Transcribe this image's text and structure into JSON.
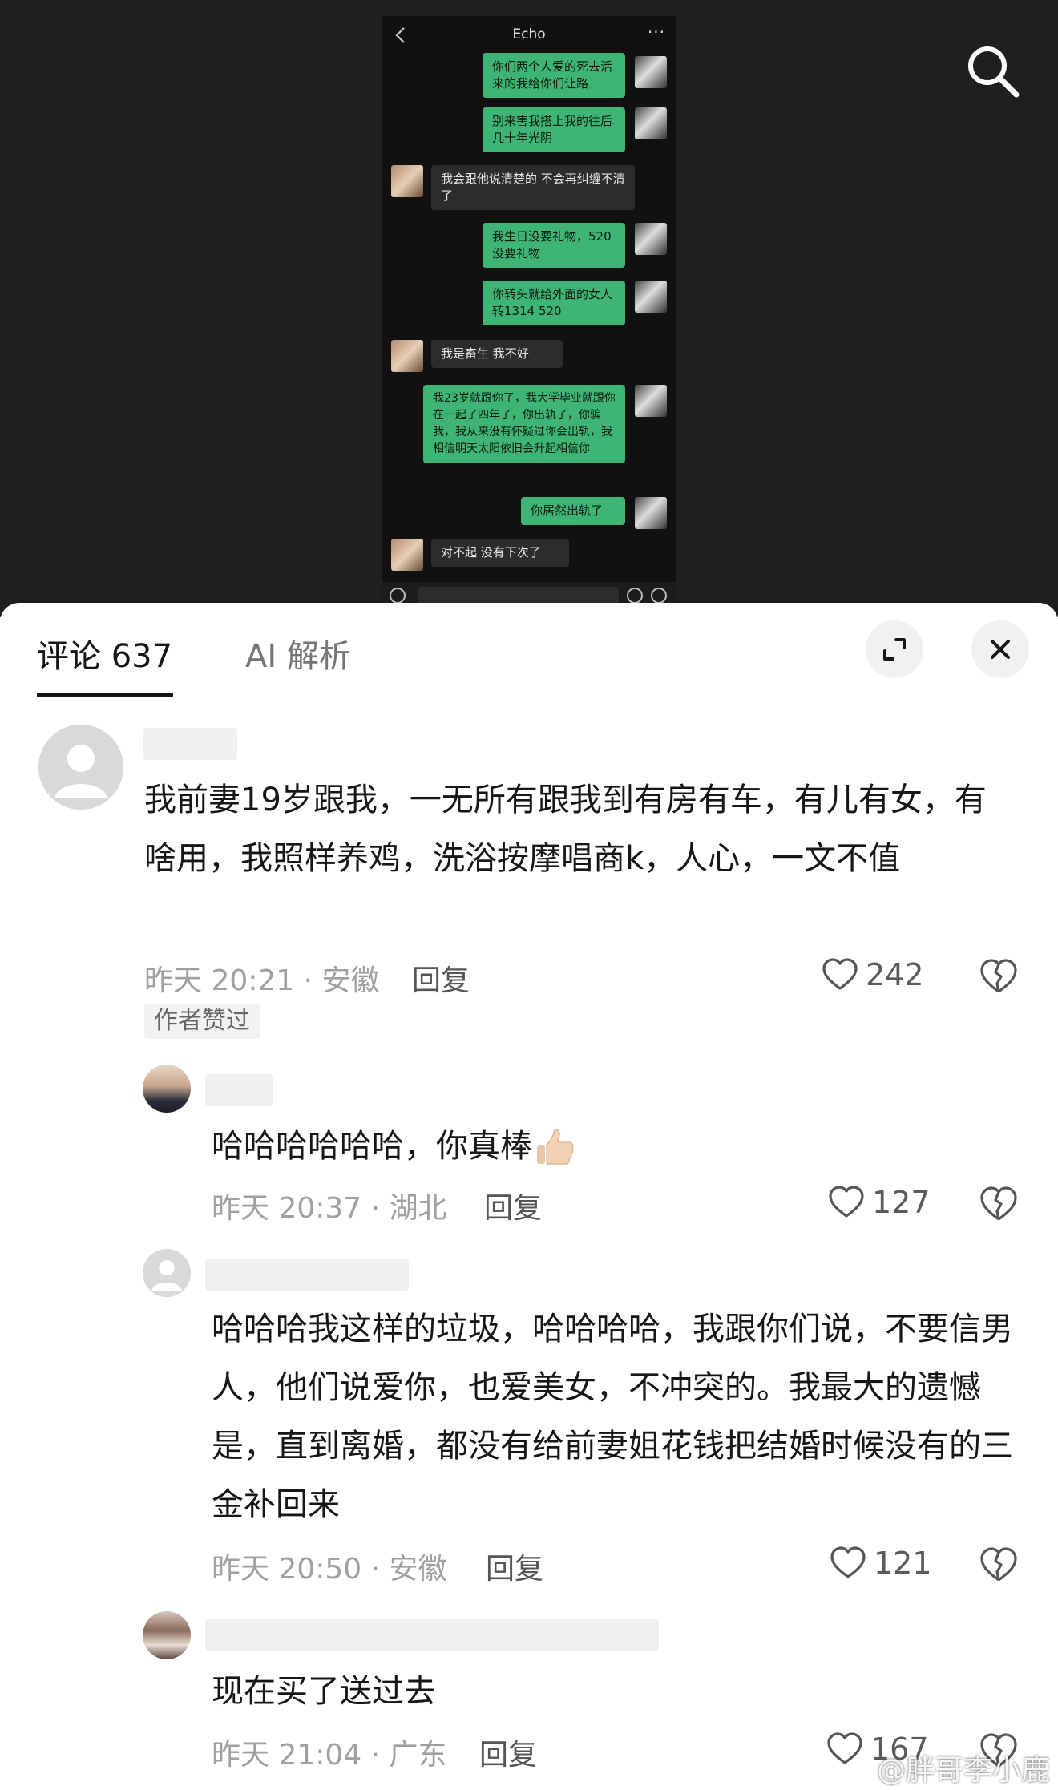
{
  "chat_screenshot": {
    "title": "Echo",
    "messages": [
      {
        "side": "right",
        "text": "你们两个人爱的死去活来的我给你们让路"
      },
      {
        "side": "right",
        "text": "别来害我搭上我的往后几十年光阴"
      },
      {
        "side": "left",
        "text": "我会跟他说清楚的 不会再纠缠不清了"
      },
      {
        "side": "right",
        "text": "我生日没要礼物，520没要礼物"
      },
      {
        "side": "right",
        "text": "你转头就给外面的女人转1314 520"
      },
      {
        "side": "left",
        "text": "我是畜生 我不好"
      },
      {
        "side": "right",
        "text": "我23岁就跟你了，我大学毕业就跟你在一起了四年了，你出轨了，你骗我，我从来没有怀疑过你会出轨，我相信明天太阳依旧会升起相信你"
      },
      {
        "side": "right",
        "text": "你居然出轨了"
      },
      {
        "side": "left",
        "text": "对不起 没有下次了"
      }
    ]
  },
  "tabs": {
    "comments_label": "评论 637",
    "ai_label": "AI 解析"
  },
  "comments": [
    {
      "text": "我前妻19岁跟我，一无所有跟我到有房有车，有儿有女，有啥用，我照样养鸡，洗浴按摩唱商k，人心，一文不值",
      "meta": "昨天 20:21 · 安徽",
      "reply_label": "回复",
      "likes": "242",
      "badge": "作者赞过"
    },
    {
      "text": "哈哈哈哈哈哈，你真棒",
      "meta": "昨天 20:37 · 湖北",
      "reply_label": "回复",
      "likes": "127"
    },
    {
      "text": "哈哈哈我这样的垃圾，哈哈哈哈，我跟你们说，不要信男人，他们说爱你，也爱美女，不冲突的。我最大的遗憾是，直到离婚，都没有给前妻姐花钱把结婚时候没有的三金补回来",
      "meta": "昨天 20:50 · 安徽",
      "reply_label": "回复",
      "likes": "121"
    },
    {
      "text": "现在买了送过去",
      "meta": "昨天 21:04 · 广东",
      "reply_label": "回复",
      "likes": "167"
    }
  ],
  "watermark": "@胖哥李小鹿",
  "colors": {
    "chat_green": "#3eb575",
    "text_primary": "#161616",
    "text_meta": "#a0a0a0"
  },
  "icons": [
    "search-icon",
    "expand-icon",
    "close-icon",
    "heart-icon",
    "broken-heart-icon",
    "thumbs-up-icon",
    "chevron-left-icon"
  ]
}
